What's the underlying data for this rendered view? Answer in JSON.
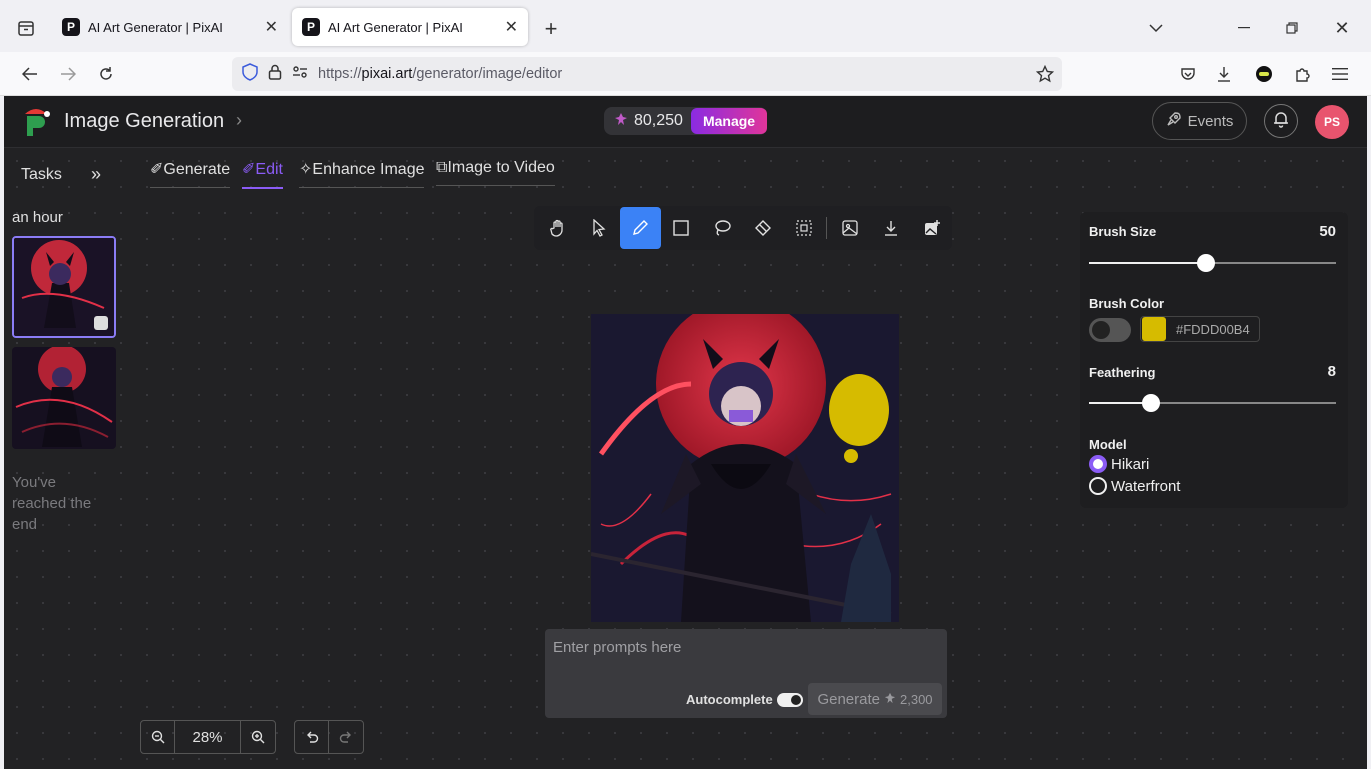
{
  "browser": {
    "tabs": [
      {
        "title": "AI Art Generator | PixAI",
        "favicon": "P",
        "active": false
      },
      {
        "title": "AI Art Generator | PixAI",
        "favicon": "P",
        "active": true
      }
    ],
    "url_prefix": "https://",
    "url_host": "pixai.art",
    "url_path": "/generator/image/editor"
  },
  "header": {
    "title": "Image Generation",
    "credits": "80,250",
    "manage_label": "Manage",
    "events_label": "Events",
    "avatar_initials": "PS"
  },
  "sidebar": {
    "tasks_label": "Tasks",
    "time_label": "an hour",
    "end_text": "You've reached the end"
  },
  "modes": {
    "generate": "Generate",
    "edit": "Edit",
    "enhance": "Enhance Image",
    "video": "Image to Video"
  },
  "prompt": {
    "placeholder": "Enter prompts here",
    "autocomplete_label": "Autocomplete",
    "generate_label": "Generate",
    "generate_cost": "2,300"
  },
  "zoom": {
    "level": "28%"
  },
  "panel": {
    "brush_size_label": "Brush Size",
    "brush_size": 50,
    "brush_color_label": "Brush Color",
    "brush_color_hex": "#FDDD00B4",
    "brush_color": "#d6bb00",
    "feathering_label": "Feathering",
    "feathering": 8,
    "model_label": "Model",
    "models": [
      {
        "name": "Hikari",
        "selected": true
      },
      {
        "name": "Waterfront",
        "selected": false
      }
    ]
  },
  "colors": {
    "accent": "#8b5cf6",
    "tool_active": "#3b82f6",
    "avatar": "#e8546e"
  }
}
